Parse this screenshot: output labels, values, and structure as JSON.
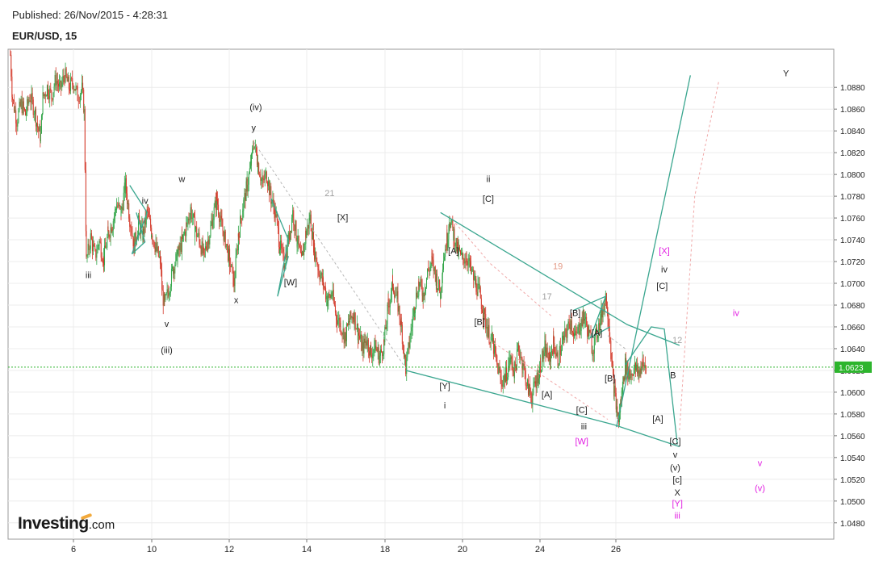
{
  "header": {
    "published": "Published: 26/Nov/2015 - 4:28:31",
    "symbol": "EUR/USD, 15"
  },
  "brand": {
    "name": "Investing",
    "tld": ".com"
  },
  "colors": {
    "wave_line": "#3aa68f",
    "dashed_grey": "#b8b8b8",
    "dashed_pink": "#f0a8a8",
    "magenta": "#e21ee2",
    "label": "#222222",
    "count_grey": "#a0a0a0",
    "count_salmon": "#e39a86",
    "candle_up": "#34a64a",
    "candle_down": "#d43b2c",
    "price_line": "#2db52d",
    "price_badge": "#2db52d"
  },
  "chart_data": {
    "type": "candlestick",
    "title": "EUR/USD, 15",
    "ylim": [
      1.0465,
      1.0915
    ],
    "y_ticks": [
      "1.0480",
      "1.0500",
      "1.0520",
      "1.0540",
      "1.0560",
      "1.0580",
      "1.0600",
      "1.0620",
      "1.0640",
      "1.0660",
      "1.0680",
      "1.0700",
      "1.0720",
      "1.0740",
      "1.0760",
      "1.0780",
      "1.0800",
      "1.0820",
      "1.0840",
      "1.0860",
      "1.0880"
    ],
    "x_ticks": [
      "6",
      "10",
      "12",
      "14",
      "18",
      "20",
      "24",
      "26"
    ],
    "grid": true,
    "current_price": "1.0623",
    "price_path": [
      [
        4.1,
        1.091
      ],
      [
        4.2,
        1.087
      ],
      [
        4.4,
        1.085
      ],
      [
        4.6,
        1.0865
      ],
      [
        4.8,
        1.0855
      ],
      [
        5.0,
        1.0872
      ],
      [
        5.2,
        1.086
      ],
      [
        5.4,
        1.084
      ],
      [
        5.5,
        1.0835
      ],
      [
        5.6,
        1.087
      ],
      [
        5.8,
        1.088
      ],
      [
        6.0,
        1.0872
      ],
      [
        6.2,
        1.0888
      ],
      [
        6.4,
        1.0878
      ],
      [
        6.6,
        1.0892
      ],
      [
        6.8,
        1.088
      ],
      [
        7.0,
        1.0885
      ],
      [
        7.2,
        1.0872
      ],
      [
        7.4,
        1.0878
      ],
      [
        7.5,
        1.086
      ],
      [
        7.6,
        1.072
      ],
      [
        7.8,
        1.0742
      ],
      [
        8.0,
        1.0725
      ],
      [
        8.2,
        1.0738
      ],
      [
        8.4,
        1.0722
      ],
      [
        8.6,
        1.0745
      ],
      [
        8.8,
        1.0755
      ],
      [
        9.0,
        1.0772
      ],
      [
        9.2,
        1.0765
      ],
      [
        9.4,
        1.079
      ],
      [
        9.6,
        1.076
      ],
      [
        9.8,
        1.0735
      ],
      [
        10.0,
        1.0755
      ],
      [
        10.2,
        1.0745
      ],
      [
        10.4,
        1.0765
      ],
      [
        10.6,
        1.0748
      ],
      [
        10.8,
        1.0732
      ],
      [
        11.0,
        1.072
      ],
      [
        11.1,
        1.069
      ],
      [
        11.2,
        1.068
      ],
      [
        11.4,
        1.0695
      ],
      [
        11.6,
        1.0715
      ],
      [
        11.8,
        1.0725
      ],
      [
        12.0,
        1.0738
      ],
      [
        12.2,
        1.0752
      ],
      [
        12.4,
        1.0768
      ],
      [
        12.6,
        1.075
      ],
      [
        12.8,
        1.074
      ],
      [
        13.0,
        1.0725
      ],
      [
        13.2,
        1.074
      ],
      [
        13.4,
        1.0758
      ],
      [
        13.6,
        1.0778
      ],
      [
        13.8,
        1.0755
      ],
      [
        14.0,
        1.074
      ],
      [
        14.2,
        1.072
      ],
      [
        14.4,
        1.07
      ],
      [
        14.6,
        1.0745
      ],
      [
        14.8,
        1.077
      ],
      [
        15.0,
        1.079
      ],
      [
        15.2,
        1.0812
      ],
      [
        15.3,
        1.083
      ],
      [
        15.5,
        1.081
      ],
      [
        15.7,
        1.0792
      ],
      [
        15.9,
        1.08
      ],
      [
        16.1,
        1.0778
      ],
      [
        16.3,
        1.0765
      ],
      [
        16.5,
        1.0735
      ],
      [
        16.7,
        1.0718
      ],
      [
        16.9,
        1.074
      ],
      [
        17.1,
        1.0765
      ],
      [
        17.3,
        1.074
      ],
      [
        17.5,
        1.072
      ],
      [
        17.7,
        1.0745
      ],
      [
        17.9,
        1.076
      ],
      [
        18.1,
        1.073
      ],
      [
        18.3,
        1.0712
      ],
      [
        18.5,
        1.07
      ],
      [
        18.7,
        1.0685
      ],
      [
        18.9,
        1.069
      ],
      [
        19.1,
        1.067
      ],
      [
        19.3,
        1.0662
      ],
      [
        19.5,
        1.065
      ],
      [
        19.7,
        1.0665
      ],
      [
        19.9,
        1.0672
      ],
      [
        20.1,
        1.0655
      ],
      [
        20.3,
        1.064
      ],
      [
        20.5,
        1.0648
      ],
      [
        20.7,
        1.0636
      ],
      [
        20.9,
        1.0642
      ],
      [
        21.1,
        1.0632
      ],
      [
        21.3,
        1.0645
      ],
      [
        21.5,
        1.068
      ],
      [
        21.7,
        1.07
      ],
      [
        21.9,
        1.0685
      ],
      [
        22.1,
        1.066
      ],
      [
        22.3,
        1.0622
      ],
      [
        22.5,
        1.065
      ],
      [
        22.7,
        1.068
      ],
      [
        22.9,
        1.07
      ],
      [
        23.1,
        1.069
      ],
      [
        23.3,
        1.071
      ],
      [
        23.5,
        1.072
      ],
      [
        23.7,
        1.0705
      ],
      [
        23.9,
        1.069
      ],
      [
        24.0,
        1.072
      ],
      [
        24.2,
        1.074
      ],
      [
        24.3,
        1.076
      ],
      [
        24.5,
        1.0745
      ],
      [
        24.7,
        1.073
      ],
      [
        24.9,
        1.0722
      ],
      [
        25.1,
        1.0725
      ],
      [
        25.3,
        1.0712
      ],
      [
        25.5,
        1.07
      ],
      [
        25.7,
        1.069
      ],
      [
        25.9,
        1.067
      ],
      [
        26.1,
        1.0655
      ],
      [
        26.3,
        1.0645
      ],
      [
        26.5,
        1.0625
      ],
      [
        26.7,
        1.061
      ],
      [
        26.9,
        1.0615
      ],
      [
        27.1,
        1.063
      ],
      [
        27.3,
        1.062
      ],
      [
        27.5,
        1.064
      ],
      [
        27.7,
        1.0625
      ],
      [
        27.9,
        1.0605
      ],
      [
        28.1,
        1.0596
      ],
      [
        28.3,
        1.061
      ],
      [
        28.5,
        1.0625
      ],
      [
        28.7,
        1.064
      ],
      [
        28.9,
        1.063
      ],
      [
        29.1,
        1.0645
      ],
      [
        29.3,
        1.063
      ],
      [
        29.5,
        1.0645
      ],
      [
        29.7,
        1.0655
      ],
      [
        29.9,
        1.0665
      ],
      [
        30.1,
        1.065
      ],
      [
        30.3,
        1.066
      ],
      [
        30.5,
        1.067
      ],
      [
        30.7,
        1.0655
      ],
      [
        30.9,
        1.064
      ],
      [
        31.1,
        1.0655
      ],
      [
        31.3,
        1.067
      ],
      [
        31.5,
        1.0688
      ],
      [
        31.6,
        1.0675
      ],
      [
        31.7,
        1.065
      ],
      [
        31.8,
        1.062
      ],
      [
        31.9,
        1.06
      ],
      [
        32.0,
        1.0585
      ],
      [
        32.1,
        1.0575
      ],
      [
        32.2,
        1.059
      ],
      [
        32.3,
        1.061
      ],
      [
        32.4,
        1.0625
      ],
      [
        32.6,
        1.0615
      ],
      [
        32.8,
        1.0622
      ],
      [
        33.0,
        1.0618
      ],
      [
        33.2,
        1.0625
      ],
      [
        33.4,
        1.0623
      ]
    ],
    "wave_lines": [
      {
        "name": "triangle-iv-left",
        "points": [
          [
            9.6,
            1.079
          ],
          [
            10.4,
            1.0765
          ],
          [
            9.7,
            1.0727
          ],
          [
            10.3,
            1.0738
          ],
          [
            9.9,
            1.0765
          ]
        ]
      },
      {
        "name": "x-triangle",
        "points": [
          [
            16.1,
            1.0778
          ],
          [
            16.9,
            1.074
          ],
          [
            16.4,
            1.0688
          ],
          [
            16.9,
            1.0725
          ]
        ]
      },
      {
        "name": "upper-channel",
        "points": [
          [
            23.9,
            1.0765
          ],
          [
            32.5,
            1.0662
          ],
          [
            34.9,
            1.0643
          ]
        ]
      },
      {
        "name": "lower-channel",
        "points": [
          [
            22.3,
            1.062
          ],
          [
            31.9,
            1.057
          ],
          [
            34.9,
            1.055
          ]
        ]
      },
      {
        "name": "b-triangle",
        "points": [
          [
            30.0,
            1.0675
          ],
          [
            31.5,
            1.0688
          ],
          [
            30.8,
            1.065
          ],
          [
            31.7,
            1.066
          ]
        ]
      },
      {
        "name": "projection-y",
        "points": [
          [
            32.0,
            1.0568
          ],
          [
            35.4,
            1.0891
          ]
        ]
      },
      {
        "name": "projection-iv-v",
        "points": [
          [
            32.4,
            1.0625
          ],
          [
            33.6,
            1.066
          ],
          [
            34.2,
            1.0658
          ],
          [
            34.8,
            1.0552
          ]
        ]
      }
    ],
    "dashed_lines": [
      {
        "name": "dashed-21",
        "color": "grey",
        "points": [
          [
            15.3,
            1.083
          ],
          [
            22.3,
            1.0622
          ]
        ]
      },
      {
        "name": "dashed-19",
        "color": "pink",
        "points": [
          [
            24.3,
            1.0762
          ],
          [
            26.2,
            1.0718
          ]
        ]
      },
      {
        "name": "dashed-17",
        "color": "pink",
        "points": [
          [
            26.2,
            1.0718
          ],
          [
            29.0,
            1.067
          ]
        ]
      },
      {
        "name": "dashed-pink-lower",
        "color": "pink",
        "points": [
          [
            26.0,
            1.065
          ],
          [
            31.6,
            1.0575
          ]
        ]
      },
      {
        "name": "dashed-12",
        "color": "grey",
        "points": [
          [
            31.6,
            1.0652
          ],
          [
            32.4,
            1.064
          ]
        ]
      },
      {
        "name": "dashed-projection",
        "color": "pink",
        "points": [
          [
            34.9,
            1.0565
          ],
          [
            35.6,
            1.078
          ],
          [
            36.7,
            1.0885
          ]
        ]
      }
    ],
    "wave_labels": [
      {
        "text": "iii",
        "x": 7.7,
        "y": 1.0705,
        "color": "label"
      },
      {
        "text": "iv",
        "x": 10.3,
        "y": 1.0773,
        "color": "label"
      },
      {
        "text": "w",
        "x": 12.0,
        "y": 1.0793,
        "color": "label"
      },
      {
        "text": "v",
        "x": 11.3,
        "y": 1.066,
        "color": "label"
      },
      {
        "text": "(iii)",
        "x": 11.3,
        "y": 1.0636,
        "color": "label"
      },
      {
        "text": "x",
        "x": 14.5,
        "y": 1.0682,
        "color": "label"
      },
      {
        "text": "(iv)",
        "x": 15.4,
        "y": 1.0859,
        "color": "label"
      },
      {
        "text": "y",
        "x": 15.3,
        "y": 1.084,
        "color": "label"
      },
      {
        "text": "21",
        "x": 18.8,
        "y": 1.078,
        "color": "count_grey"
      },
      {
        "text": "[X]",
        "x": 19.4,
        "y": 1.0758,
        "color": "label"
      },
      {
        "text": "[W]",
        "x": 17.0,
        "y": 1.0698,
        "color": "label"
      },
      {
        "text": "[Y]",
        "x": 24.1,
        "y": 1.0603,
        "color": "label"
      },
      {
        "text": "i",
        "x": 24.1,
        "y": 1.0585,
        "color": "label"
      },
      {
        "text": "[A]",
        "x": 24.5,
        "y": 1.0727,
        "color": "label"
      },
      {
        "text": "ii",
        "x": 26.1,
        "y": 1.0793,
        "color": "label"
      },
      {
        "text": "[C]",
        "x": 26.1,
        "y": 1.0775,
        "color": "label"
      },
      {
        "text": "[B]",
        "x": 25.7,
        "y": 1.0662,
        "color": "label"
      },
      {
        "text": "19",
        "x": 29.3,
        "y": 1.0713,
        "color": "count_salmon"
      },
      {
        "text": "17",
        "x": 28.8,
        "y": 1.0685,
        "color": "count_grey"
      },
      {
        "text": "[B]",
        "x": 30.1,
        "y": 1.067,
        "color": "label"
      },
      {
        "text": "[A]",
        "x": 31.1,
        "y": 1.0652,
        "color": "label"
      },
      {
        "text": "[B]",
        "x": 31.7,
        "y": 1.061,
        "color": "label"
      },
      {
        "text": "[A]",
        "x": 28.8,
        "y": 1.0595,
        "color": "label"
      },
      {
        "text": "[C]",
        "x": 30.4,
        "y": 1.0581,
        "color": "label"
      },
      {
        "text": "iii",
        "x": 30.5,
        "y": 1.0566,
        "color": "label"
      },
      {
        "text": "[W]",
        "x": 30.4,
        "y": 1.0552,
        "color": "magenta"
      },
      {
        "text": "[X]",
        "x": 34.2,
        "y": 1.0727,
        "color": "magenta"
      },
      {
        "text": "iv",
        "x": 34.2,
        "y": 1.071,
        "color": "label"
      },
      {
        "text": "[C]",
        "x": 34.1,
        "y": 1.0695,
        "color": "label"
      },
      {
        "text": "12",
        "x": 34.8,
        "y": 1.0645,
        "color": "count_grey"
      },
      {
        "text": "B",
        "x": 34.6,
        "y": 1.0613,
        "color": "label"
      },
      {
        "text": "[A]",
        "x": 33.9,
        "y": 1.0573,
        "color": "label"
      },
      {
        "text": "[C]",
        "x": 34.7,
        "y": 1.0552,
        "color": "label"
      },
      {
        "text": "v",
        "x": 34.7,
        "y": 1.054,
        "color": "label"
      },
      {
        "text": "(v)",
        "x": 34.7,
        "y": 1.0528,
        "color": "label"
      },
      {
        "text": "[c]",
        "x": 34.8,
        "y": 1.0517,
        "color": "label"
      },
      {
        "text": "X",
        "x": 34.8,
        "y": 1.0505,
        "color": "label"
      },
      {
        "text": "[Y]",
        "x": 34.8,
        "y": 1.0495,
        "color": "magenta"
      },
      {
        "text": "iii",
        "x": 34.8,
        "y": 1.0484,
        "color": "magenta"
      },
      {
        "text": "iv",
        "x": 37.5,
        "y": 1.067,
        "color": "magenta"
      },
      {
        "text": "v",
        "x": 38.6,
        "y": 1.0532,
        "color": "magenta"
      },
      {
        "text": "(v)",
        "x": 38.6,
        "y": 1.0509,
        "color": "magenta"
      },
      {
        "text": "Y",
        "x": 39.8,
        "y": 1.089,
        "color": "label"
      }
    ]
  }
}
